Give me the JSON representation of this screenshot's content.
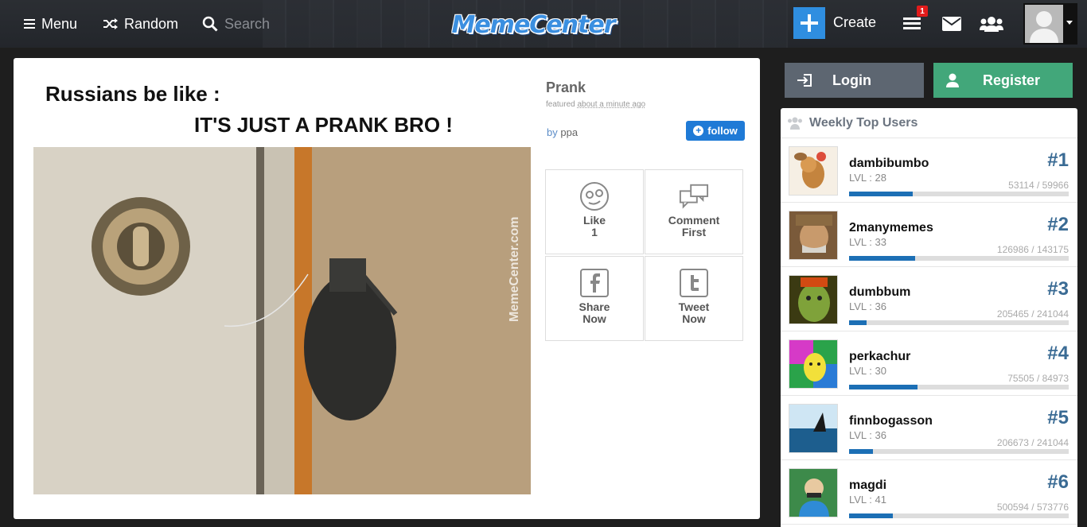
{
  "header": {
    "menu_label": "Menu",
    "random_label": "Random",
    "search_placeholder": "Search",
    "logo_text": "MemeCenter",
    "create_label": "Create",
    "notification_count": "1"
  },
  "post": {
    "caption_line1": "Russians be like :",
    "caption_line2": "IT'S JUST A PRANK BRO !",
    "watermark": "MemeCenter.com",
    "title": "Prank",
    "featured_prefix": "featured",
    "featured_time": "about a minute ago",
    "by_prefix": "by",
    "author": "ppa",
    "follow_label": "follow",
    "actions": [
      {
        "line1": "Like",
        "line2": "1"
      },
      {
        "line1": "Comment",
        "line2": "First"
      },
      {
        "line1": "Share",
        "line2": "Now"
      },
      {
        "line1": "Tweet",
        "line2": "Now"
      }
    ]
  },
  "auth": {
    "login_label": "Login",
    "register_label": "Register"
  },
  "top_users": {
    "title": "Weekly Top Users",
    "users": [
      {
        "name": "dambibumbo",
        "level": "LVL : 28",
        "rank": "#1",
        "xp": "53114 / 59966",
        "progress": 0.29
      },
      {
        "name": "2manymemes",
        "level": "LVL : 33",
        "rank": "#2",
        "xp": "126986 / 143175",
        "progress": 0.3
      },
      {
        "name": "dumbbum",
        "level": "LVL : 36",
        "rank": "#3",
        "xp": "205465 / 241044",
        "progress": 0.08
      },
      {
        "name": "perkachur",
        "level": "LVL : 30",
        "rank": "#4",
        "xp": "75505 / 84973",
        "progress": 0.31
      },
      {
        "name": "finnbogasson",
        "level": "LVL : 36",
        "rank": "#5",
        "xp": "206673 / 241044",
        "progress": 0.11
      },
      {
        "name": "magdi",
        "level": "LVL : 41",
        "rank": "#6",
        "xp": "500594 / 573776",
        "progress": 0.2
      }
    ]
  },
  "colors": {
    "accent_blue": "#2f8ee0",
    "register_green": "#42a77a",
    "login_gray": "#5d6671",
    "rank_blue": "#3a6b94",
    "progress_blue": "#1c6fb5"
  }
}
